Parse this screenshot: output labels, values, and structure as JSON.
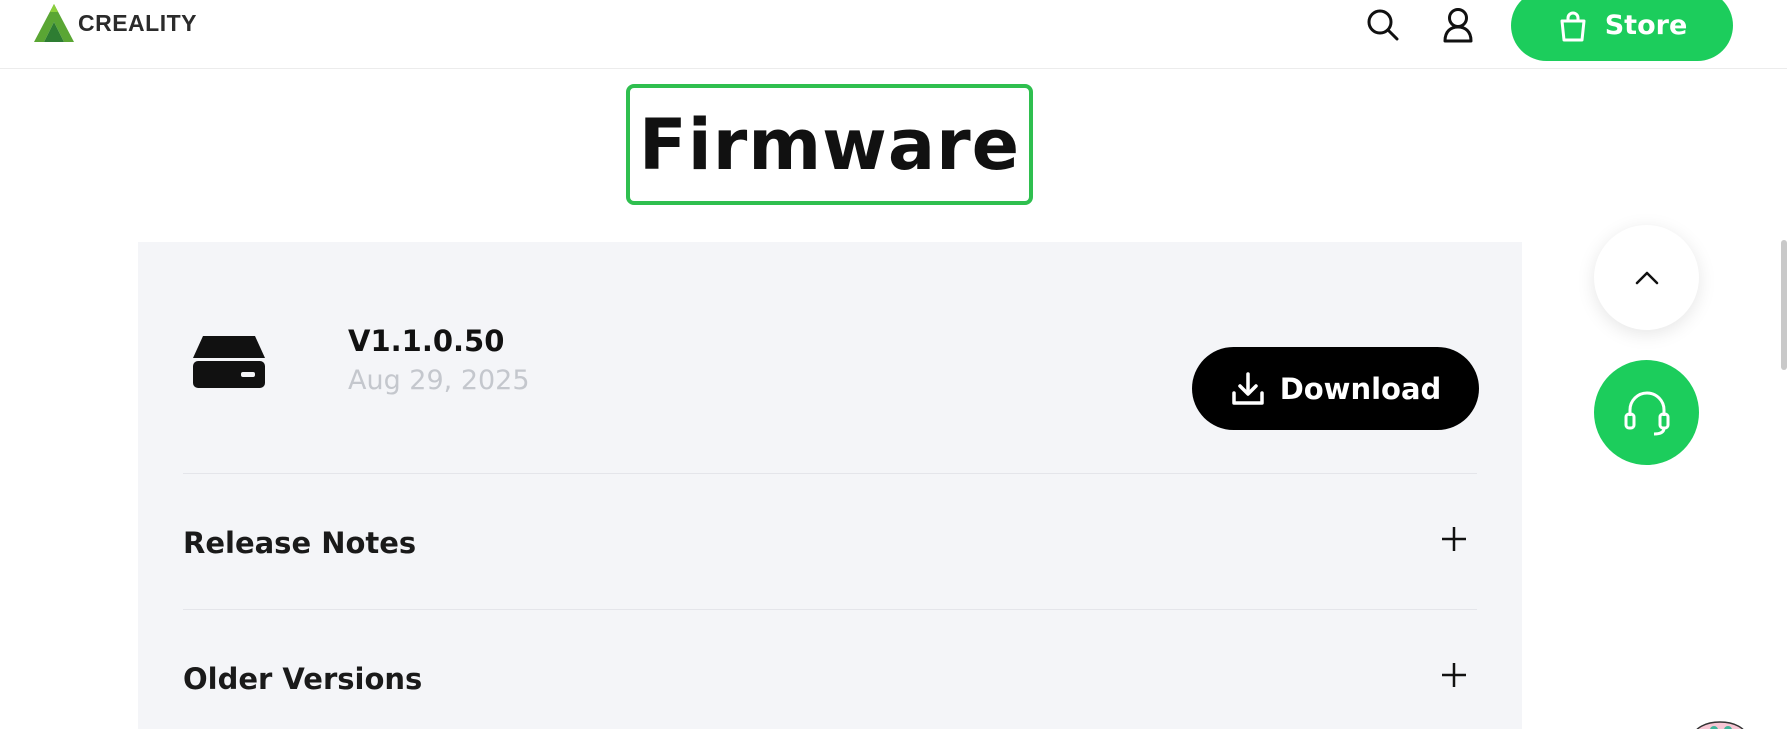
{
  "header": {
    "logo_text": "CREALITY",
    "store_label": "Store",
    "icons": [
      "search-icon",
      "user-icon",
      "shopping-bag-icon"
    ]
  },
  "page": {
    "title": "Firmware"
  },
  "firmware": {
    "version": "V1.1.0.50",
    "date": "Aug 29, 2025",
    "download_label": "Download"
  },
  "sections": [
    {
      "label": "Release Notes"
    },
    {
      "label": "Older Versions"
    }
  ],
  "colors": {
    "brand_green": "#1ccd5c",
    "title_outline": "#2fbf4f",
    "card_bg": "#f4f5f8",
    "download_bg": "#000000"
  }
}
